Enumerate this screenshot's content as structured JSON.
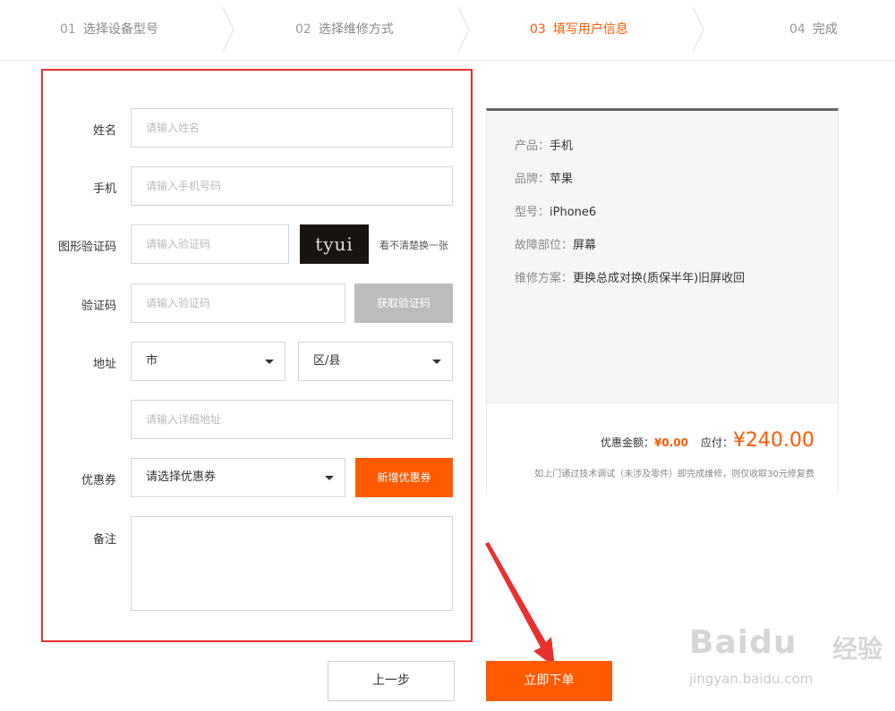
{
  "steps": [
    {
      "num": "01",
      "label": "选择设备型号"
    },
    {
      "num": "02",
      "label": "选择维修方式"
    },
    {
      "num": "03",
      "label": "填写用户信息"
    },
    {
      "num": "04",
      "label": "完成"
    }
  ],
  "colors": {
    "accent": "#ff5a00",
    "highlight_frame": "#e8312f"
  },
  "form": {
    "name_label": "姓名",
    "name_placeholder": "请输入姓名",
    "phone_label": "手机",
    "phone_placeholder": "请输入手机号码",
    "captcha_label": "图形验证码",
    "captcha_placeholder": "请输入验证码",
    "captcha_text": "tyui",
    "captcha_refresh": "看不清楚换一张",
    "sms_label": "验证码",
    "sms_placeholder": "请输入验证码",
    "sms_button": "获取验证码",
    "address_label": "地址",
    "city_select": "市",
    "district_select": "区/县",
    "address_placeholder": "请输入详细地址",
    "coupon_label": "优惠券",
    "coupon_select": "请选择优惠券",
    "coupon_button": "新增优惠券",
    "remark_label": "备注"
  },
  "summary": {
    "product_key": "产品：",
    "product_val": "手机",
    "brand_key": "品牌：",
    "brand_val": "苹果",
    "model_key": "型号：",
    "model_val": "iPhone6",
    "fault_key": "故障部位：",
    "fault_val": "屏幕",
    "plan_key": "维修方案：",
    "plan_val": "更换总成对换(质保半年)旧屏收回",
    "discount_label": "优惠金额：",
    "discount_value": "¥0.00",
    "payable_label": "应付：",
    "payable_value": "¥240.00",
    "note": "如上门通过技术调试（未涉及零件）即完成维修，则仅收取30元修复费"
  },
  "actions": {
    "prev": "上一步",
    "submit": "立即下单"
  },
  "watermark": {
    "logo": "Baidu",
    "logo_cn": "经验",
    "url": "jingyan.baidu.com"
  }
}
